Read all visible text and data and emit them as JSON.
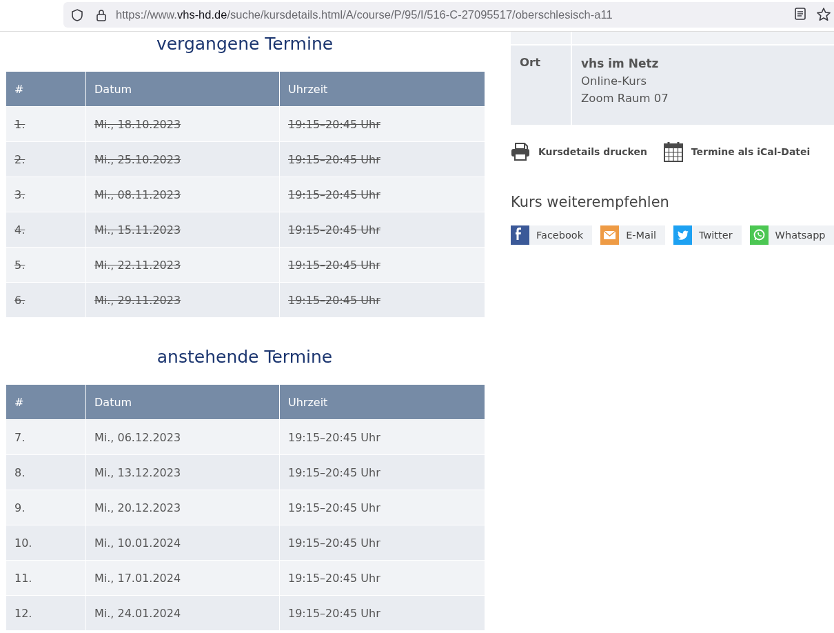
{
  "browser": {
    "url": {
      "scheme": "https://www.",
      "host": "vhs-hd.de",
      "path": "/suche/kursdetails.html/A/course/P/95/I/516-C-27095517/oberschlesisch-a11"
    }
  },
  "schedules": [
    {
      "title": "vergangene Termine",
      "columns": [
        "#",
        "Datum",
        "Uhrzeit"
      ],
      "rows": [
        {
          "cells": [
            "1.",
            "Mi., 18.10.2023",
            "19:15–20:45 Uhr"
          ],
          "past": true
        },
        {
          "cells": [
            "2.",
            "Mi., 25.10.2023",
            "19:15–20:45 Uhr"
          ],
          "past": true
        },
        {
          "cells": [
            "3.",
            "Mi., 08.11.2023",
            "19:15–20:45 Uhr"
          ],
          "past": true
        },
        {
          "cells": [
            "4.",
            "Mi., 15.11.2023",
            "19:15–20:45 Uhr"
          ],
          "past": true
        },
        {
          "cells": [
            "5.",
            "Mi., 22.11.2023",
            "19:15–20:45 Uhr"
          ],
          "past": true
        },
        {
          "cells": [
            "6.",
            "Mi., 29.11.2023",
            "19:15–20:45 Uhr"
          ],
          "past": true
        }
      ]
    },
    {
      "title": "anstehende Termine",
      "columns": [
        "#",
        "Datum",
        "Uhrzeit"
      ],
      "rows": [
        {
          "cells": [
            "7.",
            "Mi., 06.12.2023",
            "19:15–20:45 Uhr"
          ],
          "past": false
        },
        {
          "cells": [
            "8.",
            "Mi., 13.12.2023",
            "19:15–20:45 Uhr"
          ],
          "past": false
        },
        {
          "cells": [
            "9.",
            "Mi., 20.12.2023",
            "19:15–20:45 Uhr"
          ],
          "past": false
        },
        {
          "cells": [
            "10.",
            "Mi., 10.01.2024",
            "19:15–20:45 Uhr"
          ],
          "past": false
        },
        {
          "cells": [
            "11.",
            "Mi., 17.01.2024",
            "19:15–20:45 Uhr"
          ],
          "past": false
        },
        {
          "cells": [
            "12.",
            "Mi., 24.01.2024",
            "19:15–20:45 Uhr"
          ],
          "past": false
        }
      ]
    }
  ],
  "details": {
    "rows": [
      {
        "label": "Ort",
        "name": "vhs im Netz",
        "lines": [
          "Online-Kurs",
          "Zoom Raum 07"
        ]
      }
    ]
  },
  "actions": [
    {
      "kind": "print",
      "label": "Kursdetails drucken"
    },
    {
      "kind": "calendar",
      "label": "Termine als iCal-Datei"
    }
  ],
  "share": {
    "title": "Kurs weiterempfehlen",
    "buttons": [
      {
        "kind": "facebook",
        "label": "Facebook",
        "color": "#3b5998"
      },
      {
        "kind": "email",
        "label": "E-Mail",
        "color": "#ee9b45"
      },
      {
        "kind": "twitter",
        "label": "Twitter",
        "color": "#1da1f2"
      },
      {
        "kind": "whatsapp",
        "label": "Whatsapp",
        "color": "#4cc753"
      }
    ]
  }
}
